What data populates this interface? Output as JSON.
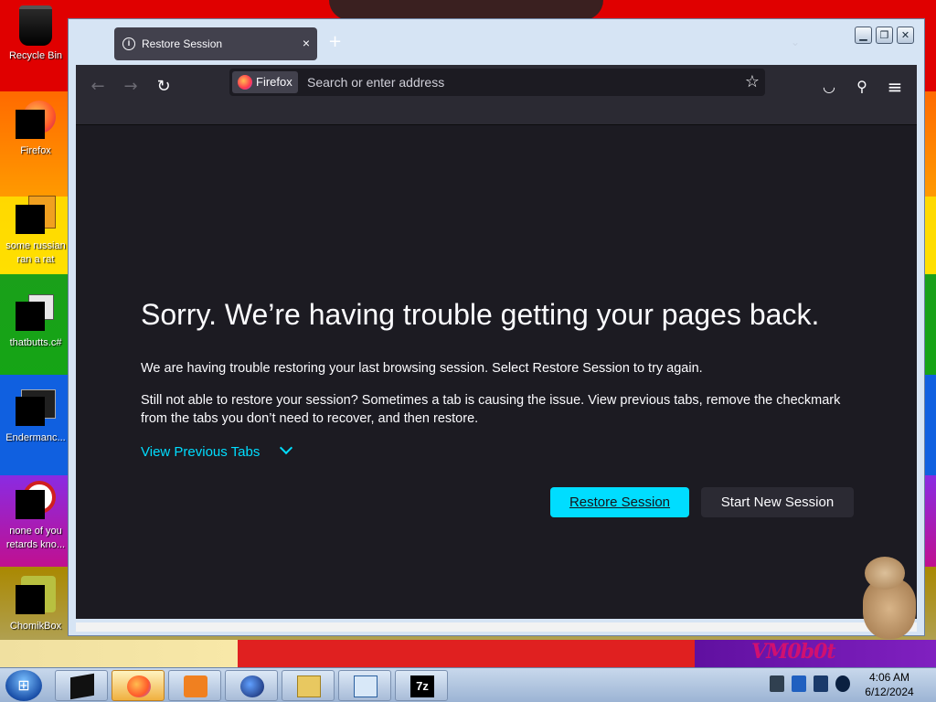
{
  "desktop": {
    "icons": [
      {
        "label": "Recycle Bin",
        "icon": "recycle-bin-icon"
      },
      {
        "label": "Firefox",
        "icon": "firefox-icon"
      },
      {
        "label": "some russian ran a rat",
        "icon": "app-icon"
      },
      {
        "label": "thatbutts.c#",
        "icon": "app-icon"
      },
      {
        "label": "Endermanc...",
        "icon": "app-icon"
      },
      {
        "label": "none of you retards kno...",
        "icon": "app-icon"
      },
      {
        "label": "ChomikBox",
        "icon": "chomikbox-icon"
      }
    ],
    "wallpaper_text": "VM0b0t"
  },
  "window": {
    "tab": {
      "title": "Restore Session",
      "close": "×"
    },
    "new_tab": "+",
    "controls": {
      "minimize": "▁",
      "maximize": "❐",
      "close": "✕"
    }
  },
  "toolbar": {
    "back": "←",
    "forward": "→",
    "reload": "↻",
    "identity_label": "Firefox",
    "url_placeholder": "Search or enter address",
    "url_value": "",
    "bookmark": "☆",
    "pocket": "◡",
    "extensions": "⚲",
    "menu": "≡"
  },
  "page": {
    "heading": "Sorry. We’re having trouble getting your pages back.",
    "para1": "We are having trouble restoring your last browsing session. Select Restore Session to try again.",
    "para2": "Still not able to restore your session? Sometimes a tab is causing the issue. View previous tabs, remove the checkmark from the tabs you don’t need to recover, and then restore.",
    "view_previous_tabs": "View Previous Tabs",
    "restore_button": "Restore Session",
    "new_session_button": "Start New Session"
  },
  "taskbar": {
    "start": "⊞",
    "clock_time": "4:06 AM",
    "clock_date": "6/12/2024"
  },
  "colors": {
    "accent": "#00ddff",
    "page_bg": "#1c1b22",
    "toolbar_bg": "#2b2a33"
  }
}
